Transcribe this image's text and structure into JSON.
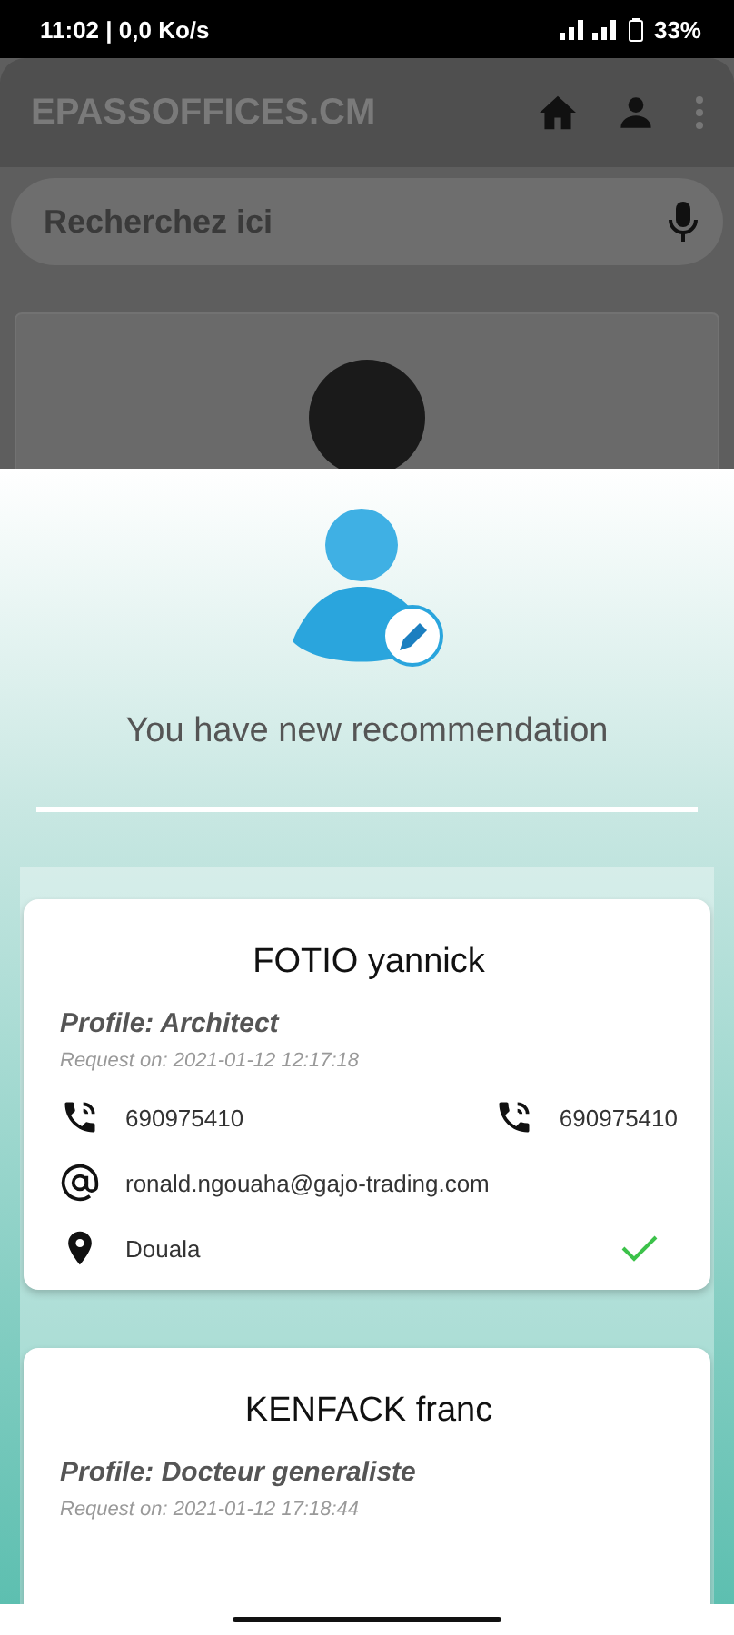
{
  "status_bar": {
    "time": "11:02 | 0,0 Ko/s",
    "battery": "33%"
  },
  "app_bar": {
    "title": "EPASSOFFICES.CM"
  },
  "search": {
    "placeholder": "Recherchez ici"
  },
  "sheet": {
    "message": "You have new recommendation",
    "recommendations": [
      {
        "name": "FOTIO yannick",
        "profile": "Profile: Architect",
        "requested": "Request on: 2021-01-12 12:17:18",
        "phone": "690975410",
        "phone_2": "690975410",
        "email": "ronald.ngouaha@gajo-trading.com",
        "city": "Douala",
        "confirmed": true
      },
      {
        "name": "KENFACK franc",
        "profile": "Profile: Docteur generaliste",
        "requested": "Request on: 2021-01-12 17:18:44"
      }
    ]
  }
}
